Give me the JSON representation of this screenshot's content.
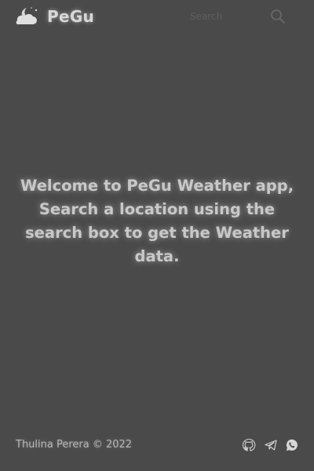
{
  "header": {
    "brand": "PeGu",
    "logo_icon": "moon-cloud-icon",
    "search_placeholder": "Search",
    "search_icon": "search-icon"
  },
  "main": {
    "welcome_text": "Welcome to PeGu Weather app, Search a location using the search box to get the Weather data."
  },
  "footer": {
    "copyright": "Thulina Perera © 2022",
    "social": [
      {
        "icon": "github-icon"
      },
      {
        "icon": "telegram-icon"
      },
      {
        "icon": "whatsapp-icon"
      }
    ]
  },
  "colors": {
    "background": "#4a4a4a",
    "text": "#cfcfcf"
  }
}
